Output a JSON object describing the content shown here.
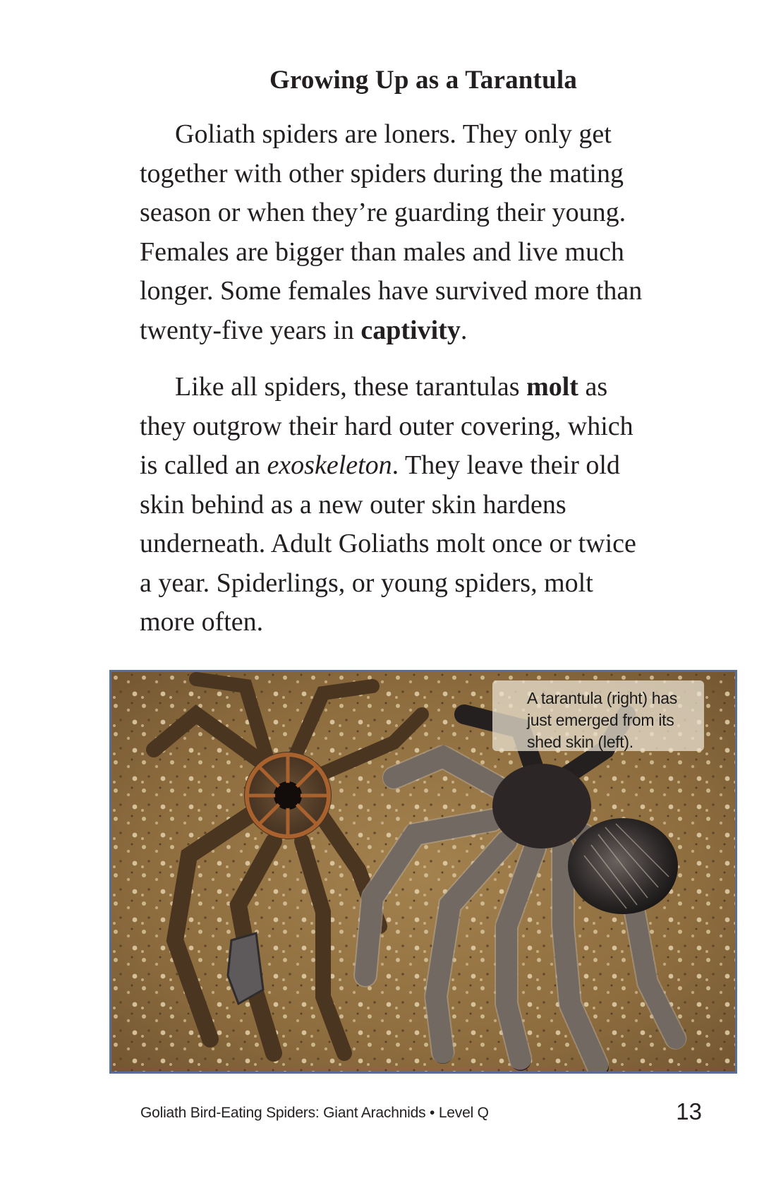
{
  "heading": "Growing Up as a Tarantula",
  "paragraph1": {
    "lines": [
      "Goliath spiders are loners. They only get",
      "together with other spiders during the mating",
      "season or when they’re guarding their young.",
      "Females are bigger than males and live much",
      "longer. Some females have survived more than"
    ],
    "last_line_before": "twenty-five years in ",
    "last_line_bold": "captivity",
    "last_line_after": "."
  },
  "paragraph2": {
    "line1_before": "Like all spiders, these tarantulas ",
    "line1_bold": "molt",
    "line1_after": " as",
    "line2": "they outgrow their hard outer covering, which",
    "line3_before": "is called an ",
    "line3_italic": "exoskeleton",
    "line3_after": ". They leave their old",
    "lines_rest": [
      "skin behind as a new outer skin hardens",
      "underneath. Adult Goliaths molt once or twice",
      "a year. Spiderlings, or young spiders, molt",
      "more often."
    ]
  },
  "photo": {
    "caption_lines": [
      "A tarantula (right) has",
      "just emerged from its",
      "shed skin (left)."
    ],
    "frame_color": "#5a6d96"
  },
  "footer": {
    "book_title": "Goliath Bird-Eating Spiders: Giant Arachnids • Level Q",
    "page_number": "13"
  }
}
